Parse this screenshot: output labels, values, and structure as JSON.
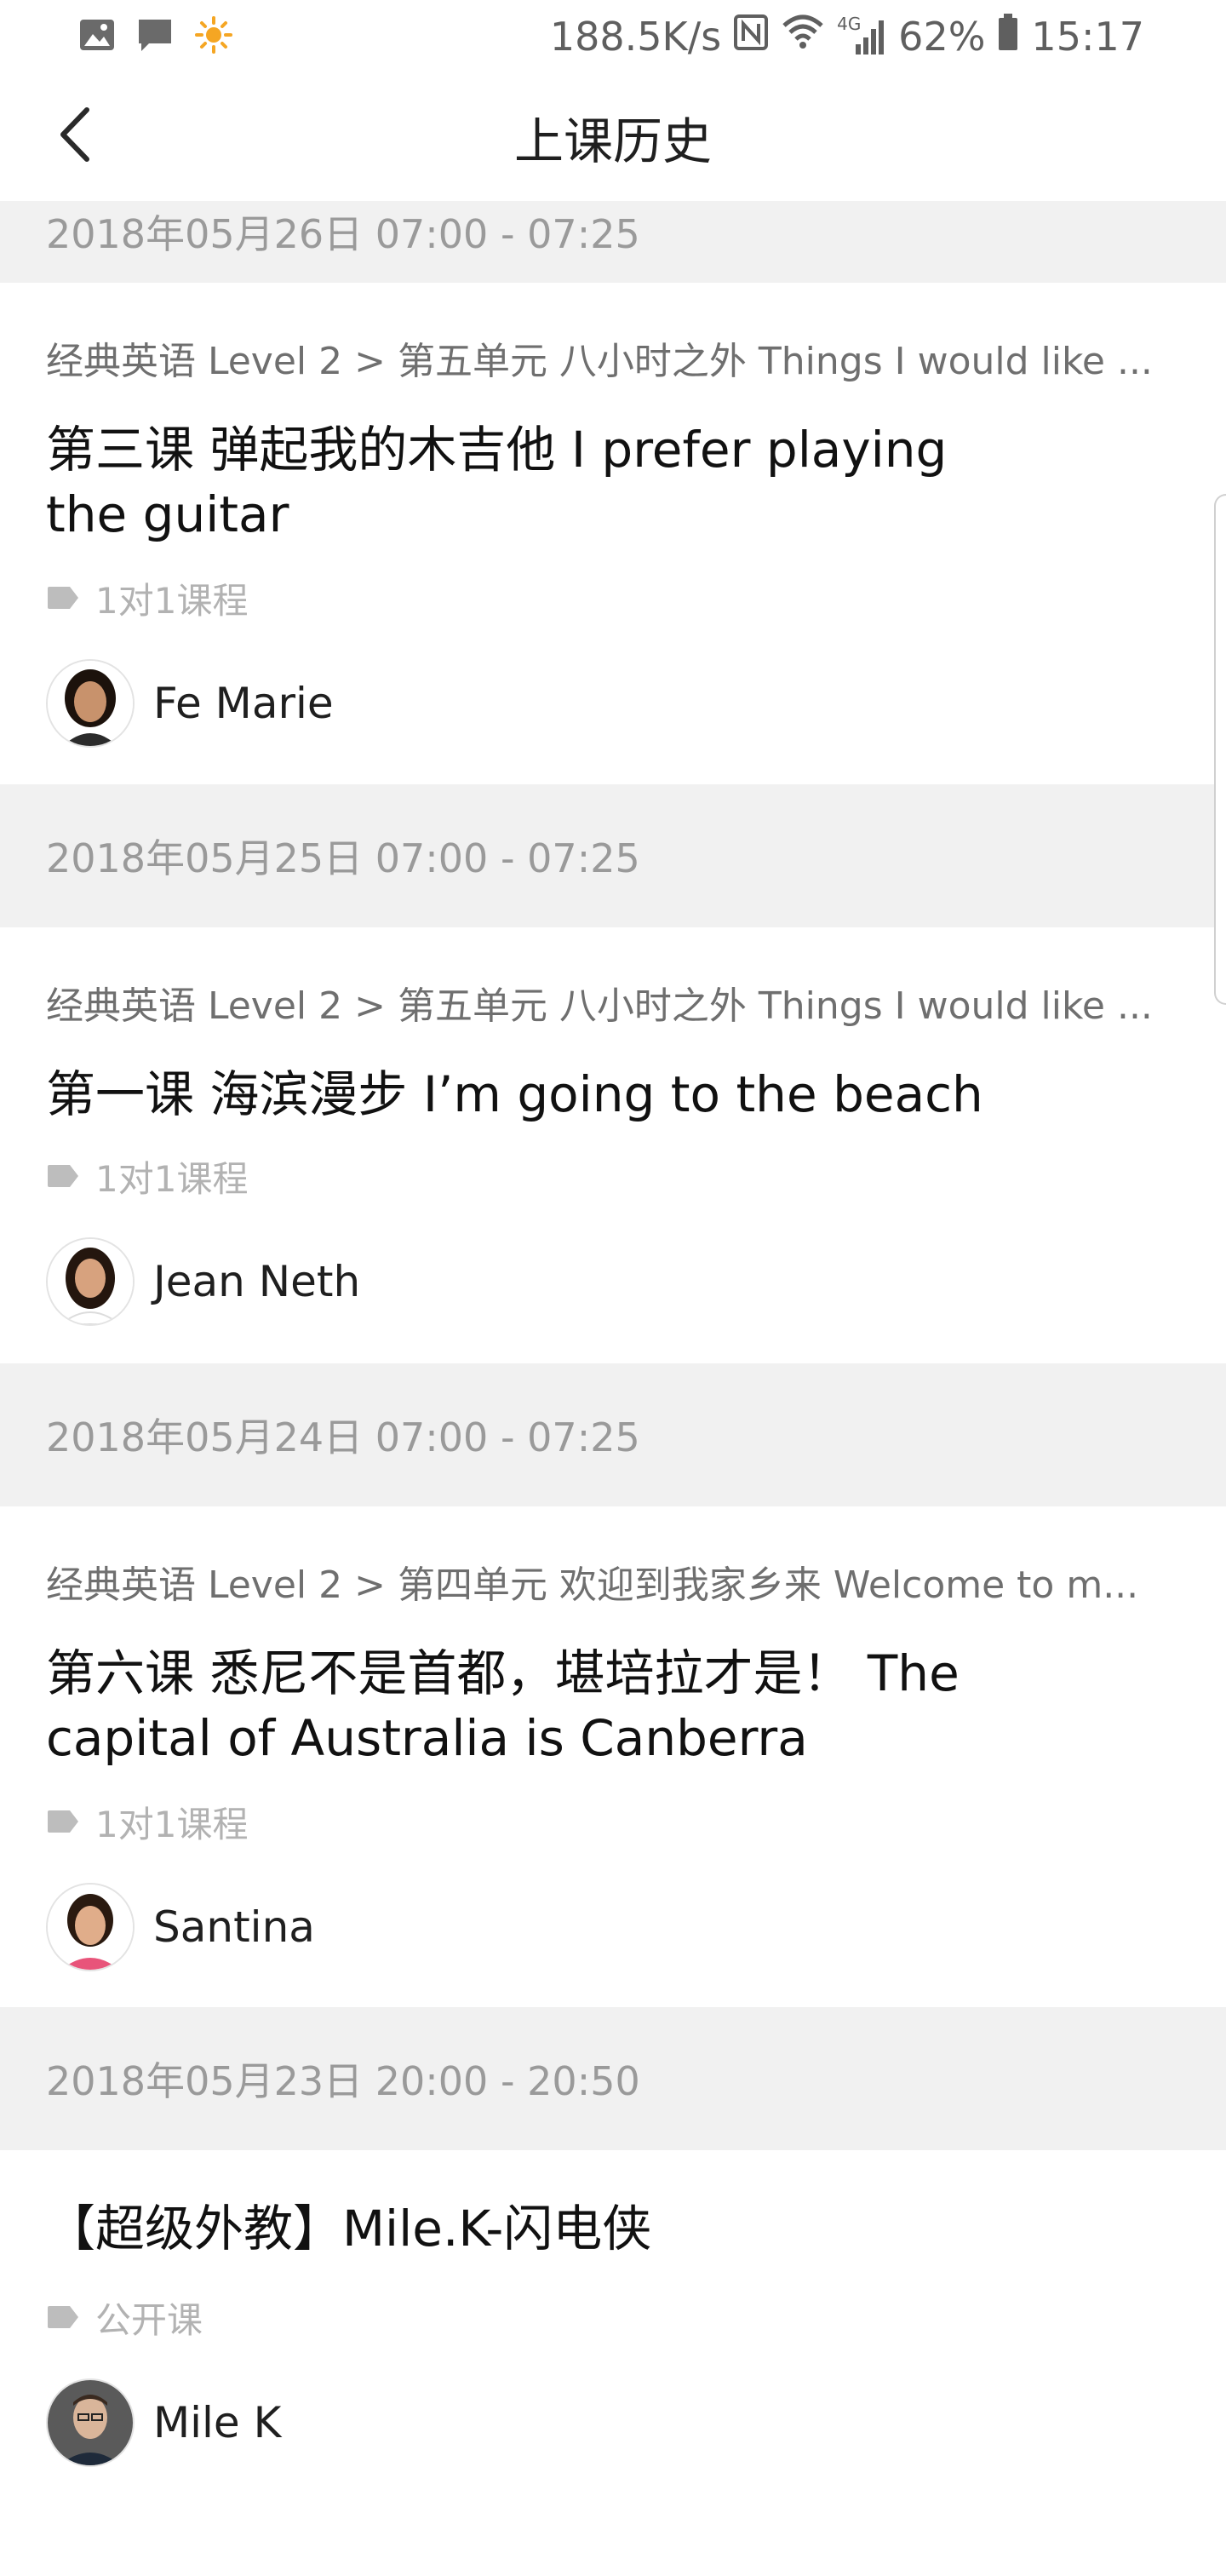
{
  "status_bar": {
    "network_speed": "188.5K/s",
    "network_type": "4G",
    "battery": "62%",
    "time": "15:17",
    "icons": [
      "image-icon",
      "message-icon",
      "sun-icon",
      "nfc-icon",
      "wifi-icon",
      "signal-icon",
      "battery-icon"
    ]
  },
  "header": {
    "title": "上课历史",
    "back_icon": "chevron-left-icon"
  },
  "records": [
    {
      "date": "2018年05月26日 07:00 - 07:25",
      "breadcrumb": "经典英语 Level 2 > 第五单元 八小时之外 Things I would like ...",
      "title": "第三课 弹起我的木吉他 I prefer playing the guitar",
      "tag": "1对1课程",
      "teacher": "Fe Marie"
    },
    {
      "date": "2018年05月25日 07:00 - 07:25",
      "breadcrumb": "经典英语 Level 2 > 第五单元 八小时之外 Things I would like ...",
      "title": "第一课 海滨漫步 I’m going to the beach",
      "tag": "1对1课程",
      "teacher": "Jean Neth"
    },
    {
      "date": "2018年05月24日 07:00 - 07:25",
      "breadcrumb": "经典英语 Level 2 > 第四单元 欢迎到我家乡来 Welcome to m...",
      "title": "第六课 悉尼不是首都，堪培拉才是！ The capital of Australia is Canberra",
      "tag": "1对1课程",
      "teacher": "Santina"
    },
    {
      "date": "2018年05月23日 20:00 - 20:50",
      "breadcrumb": "",
      "title": "【超级外教】Mile.K-闪电侠",
      "tag": "公开课",
      "teacher": "Mile K"
    }
  ],
  "colors": {
    "band_bg": "#f1f1f1",
    "muted_text": "#9a9a9a",
    "tag_icon": "#bdbdbd",
    "primary_text": "#111111"
  }
}
